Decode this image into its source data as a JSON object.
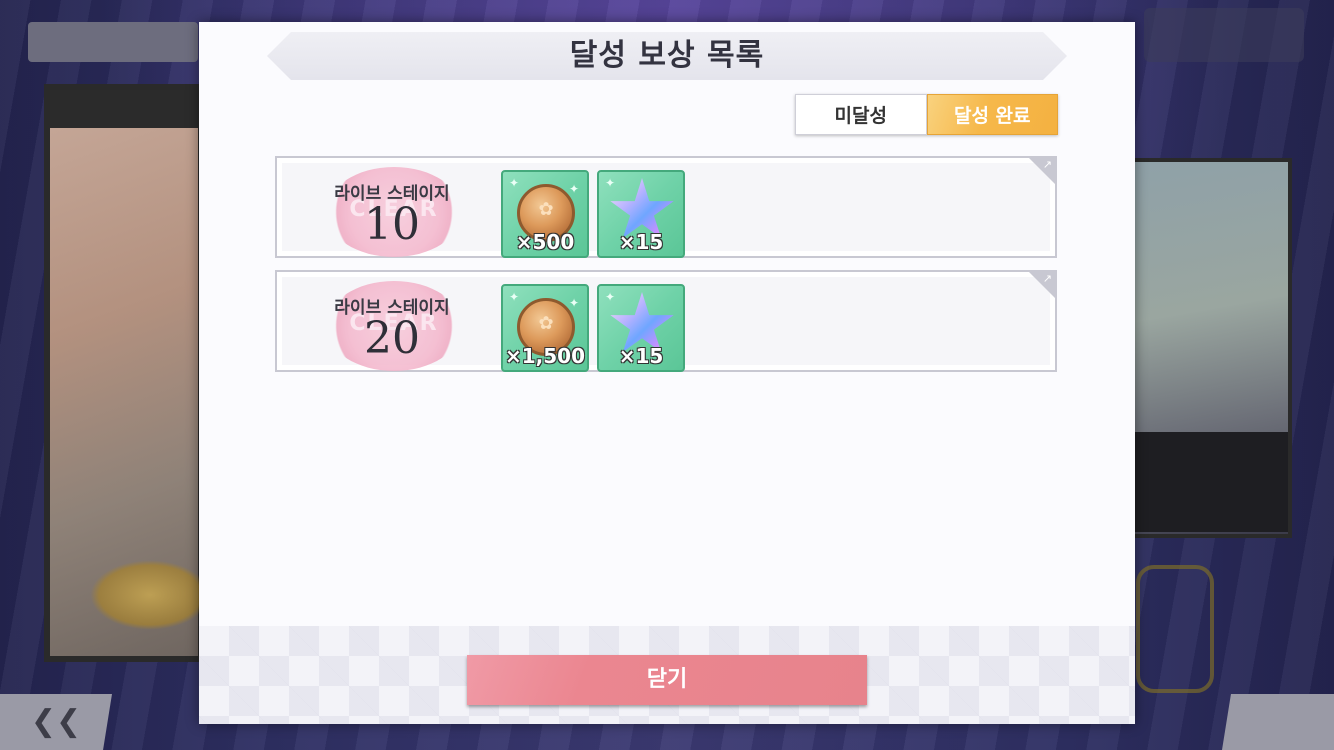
{
  "modal": {
    "title": "달성 보상 목록",
    "tabs": [
      {
        "label": "미달성",
        "active": false
      },
      {
        "label": "달성 완료",
        "active": true
      }
    ],
    "rows": [
      {
        "label": "라이브 스테이지",
        "count": "10",
        "rewards": [
          {
            "icon": "coin-icon",
            "qty": "×500"
          },
          {
            "icon": "star-gem-icon",
            "qty": "×15"
          }
        ]
      },
      {
        "label": "라이브 스테이지",
        "count": "20",
        "rewards": [
          {
            "icon": "coin-icon",
            "qty": "×1,500"
          },
          {
            "icon": "star-gem-icon",
            "qty": "×15"
          }
        ]
      }
    ],
    "close_label": "닫기"
  },
  "colors": {
    "tab_active": "#f6b84a",
    "close_button": "#e7838c",
    "item_bg": "#6fd2a8"
  }
}
